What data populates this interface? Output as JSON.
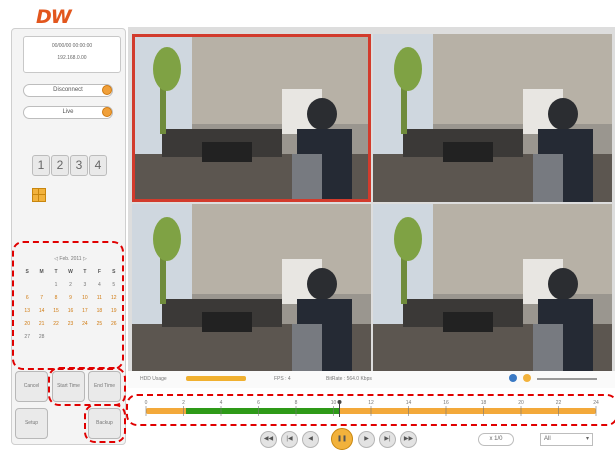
{
  "brand": {
    "logo_text": "DW"
  },
  "info": {
    "line1": "00/00/00 00:00:00",
    "line2": "192.168.0.00"
  },
  "controls": {
    "connect_label": "Disconnect",
    "mode_label": "Live"
  },
  "split_buttons": [
    "1",
    "2",
    "3",
    "4"
  ],
  "calendar": {
    "header": "Feb. 2011",
    "weekdays": [
      "S",
      "M",
      "T",
      "W",
      "T",
      "F",
      "S"
    ],
    "days": [
      "",
      "",
      "1",
      "2",
      "3",
      "4",
      "5",
      "6",
      "7",
      "8",
      "9",
      "10",
      "11",
      "12",
      "13",
      "14",
      "15",
      "16",
      "17",
      "18",
      "19",
      "20",
      "21",
      "22",
      "23",
      "24",
      "25",
      "26",
      "27",
      "28",
      "",
      "",
      "",
      "",
      ""
    ]
  },
  "side_buttons": {
    "cancel": "Cancel",
    "start_time": "Start Time",
    "end_time": "End Time",
    "setup": "Setup",
    "backup": "Backup"
  },
  "status": {
    "hdd_label": "HDD Usage",
    "fps_label": "FPS : 4",
    "bitrate_label": "BitRate : 564.0 Kbps"
  },
  "timeline": {
    "ticks": [
      "0",
      "2",
      "4",
      "6",
      "8",
      "10",
      "12",
      "14",
      "16",
      "18",
      "20",
      "22",
      "24"
    ],
    "recorded_fraction": 0.43
  },
  "playback": {
    "speed_label": "x 1/0",
    "channel_value": "All",
    "buttons": [
      "rewind-fast",
      "step-back",
      "rewind",
      "pause",
      "forward",
      "step-forward",
      "forward-fast"
    ]
  },
  "colors": {
    "accent": "#f2b23c",
    "selection": "#d23b2c",
    "timeline_rec": "#2e9a18",
    "timeline_bg": "#f3a93a",
    "highlight_box": "#e00000"
  }
}
